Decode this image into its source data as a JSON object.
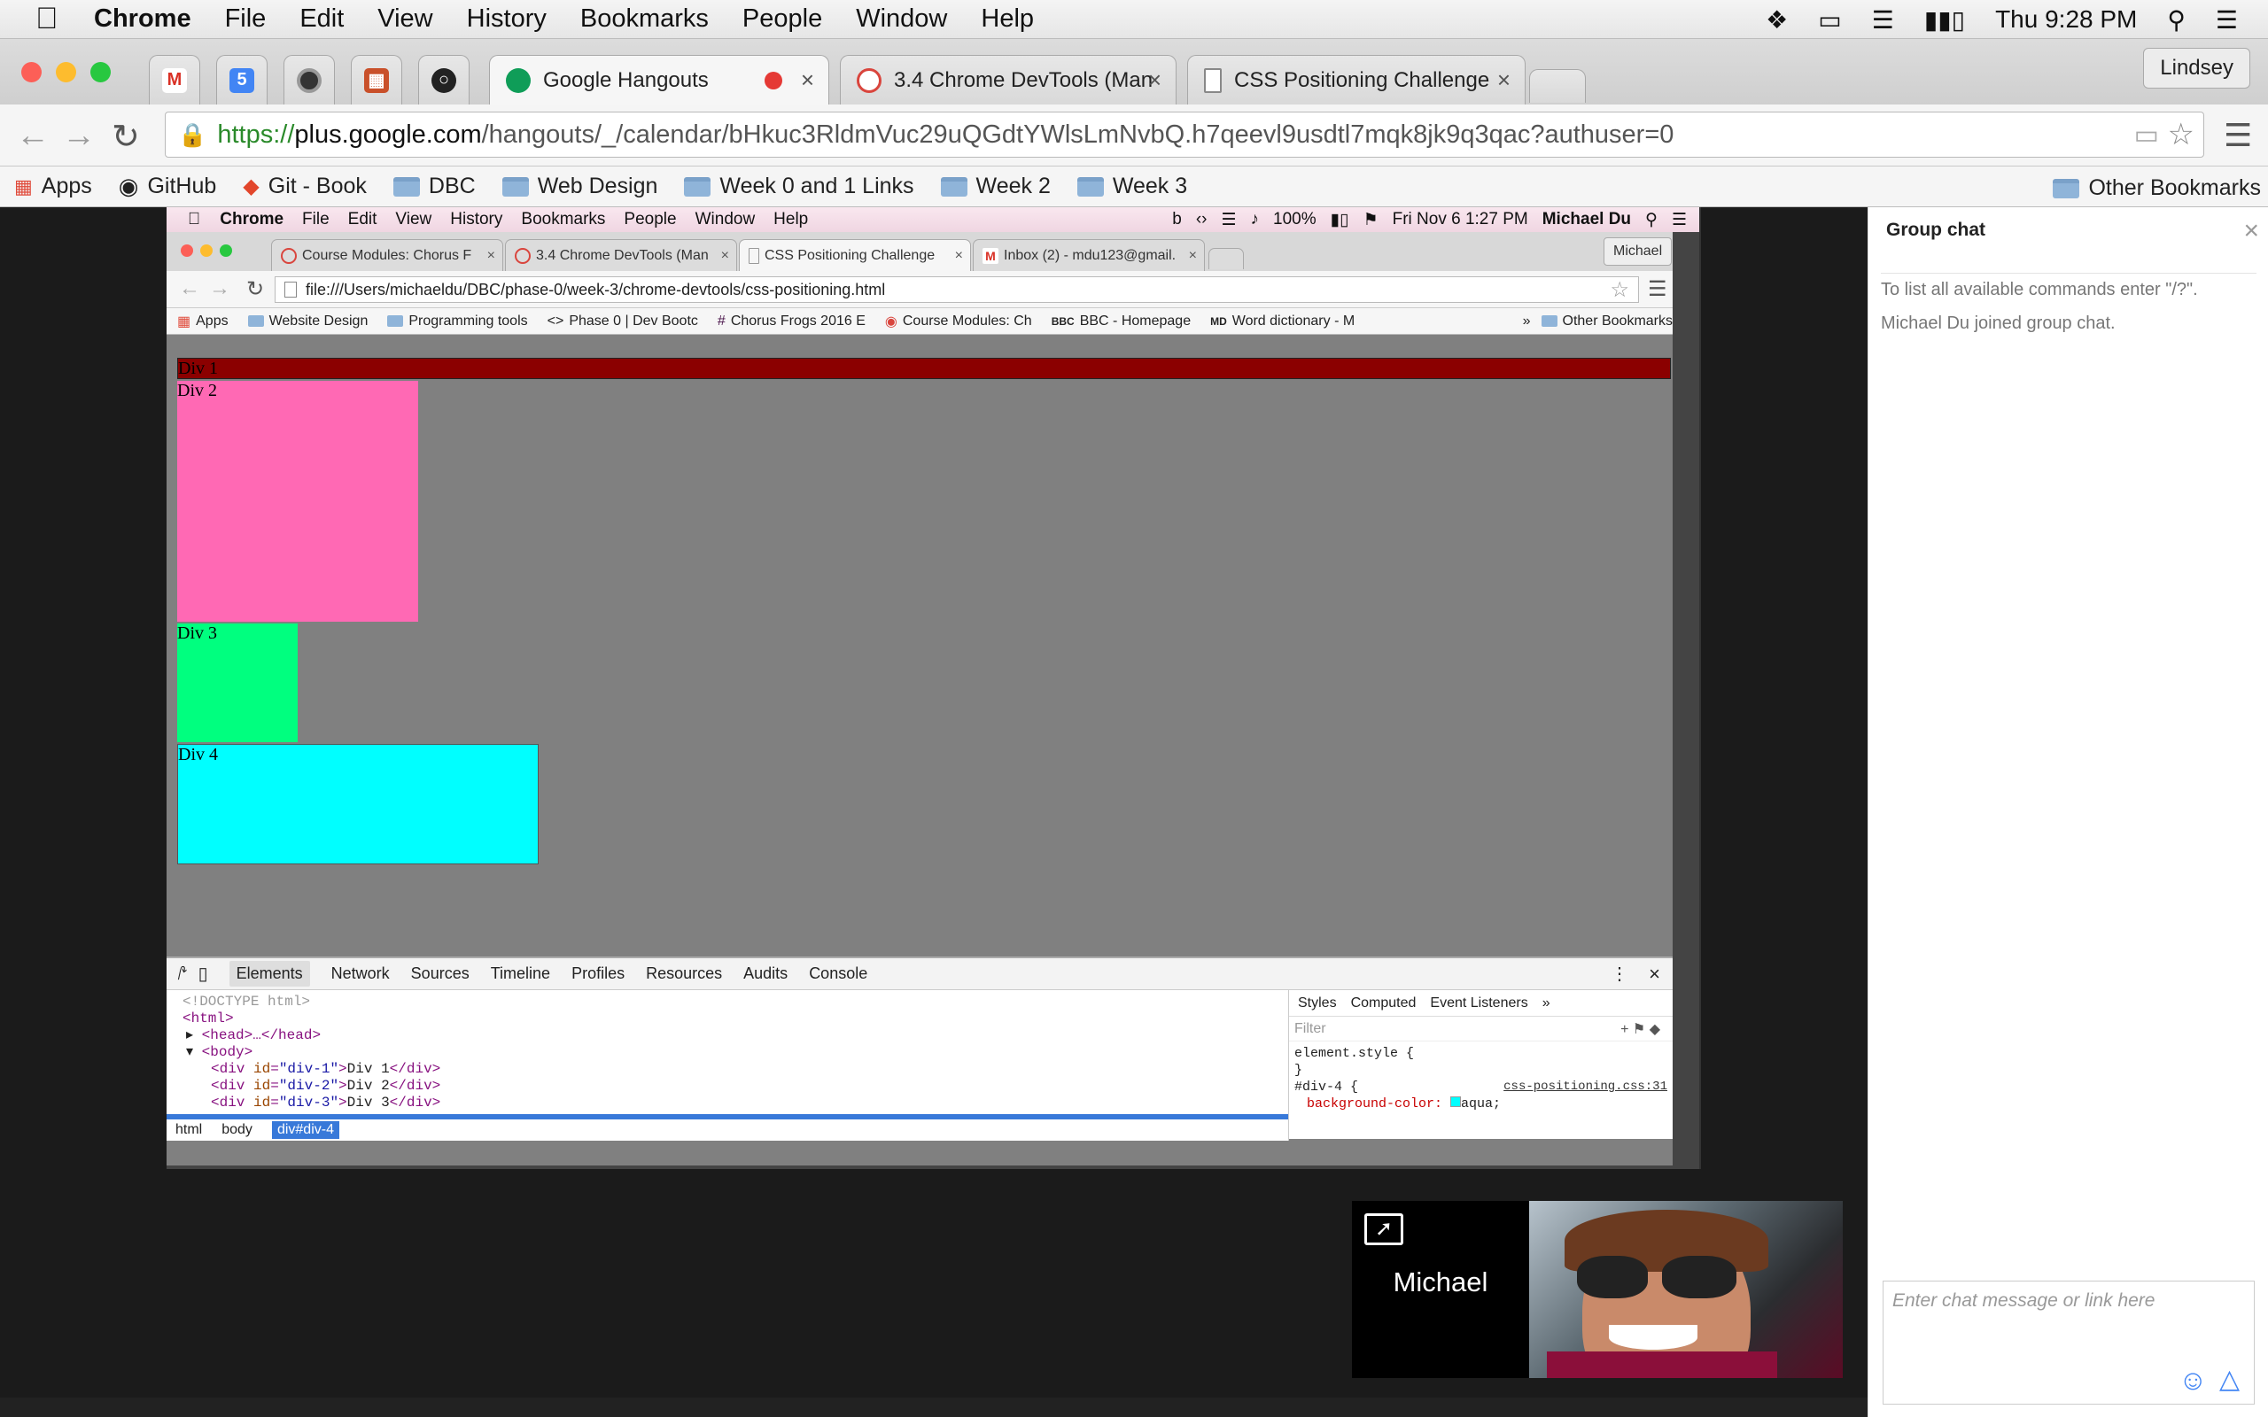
{
  "menubar": {
    "app": "Chrome",
    "items": [
      "File",
      "Edit",
      "View",
      "History",
      "Bookmarks",
      "People",
      "Window",
      "Help"
    ],
    "clock": "Thu 9:28 PM"
  },
  "tabs": [
    {
      "label": "Google Hangouts"
    },
    {
      "label": "3.4 Chrome DevTools (Man"
    },
    {
      "label": "CSS Positioning Challenge"
    }
  ],
  "profile": "Lindsey",
  "omnibox": {
    "scheme": "https://",
    "host": "plus.google.com",
    "path": "/hangouts/_/calendar/bHkuc3RldmVuc29uQGdtYWlsLmNvbQ.h7qeevl9usdtl7mqk8jk9q3qac?authuser=0"
  },
  "bookmarks": [
    "Apps",
    "GitHub",
    "Git - Book",
    "DBC",
    "Web Design",
    "Week 0 and 1 Links",
    "Week 2",
    "Week 3",
    "Other Bookmarks"
  ],
  "inner": {
    "menubar": {
      "app": "Chrome",
      "items": [
        "File",
        "Edit",
        "View",
        "History",
        "Bookmarks",
        "People",
        "Window",
        "Help"
      ],
      "battery": "100%",
      "clock": "Fri Nov 6  1:27 PM",
      "user": "Michael Du"
    },
    "tabs": [
      "Course Modules: Chorus F",
      "3.4 Chrome DevTools (Man",
      "CSS Positioning Challenge",
      "Inbox (2) - mdu123@gmail."
    ],
    "profile": "Michael",
    "url": "file:///Users/michaeldu/DBC/phase-0/week-3/chrome-devtools/css-positioning.html",
    "bookmarks": [
      "Apps",
      "Website Design",
      "Programming tools",
      "Phase 0 | Dev Bootc",
      "Chorus Frogs 2016 E",
      "Course Modules: Ch",
      "BBC - Homepage",
      "Word dictionary - M",
      "Other Bookmarks"
    ],
    "divs": [
      {
        "label": "Div 1",
        "color": "#8b0000"
      },
      {
        "label": "Div 2",
        "color": "#ff69b4"
      },
      {
        "label": "Div 3",
        "color": "#00ff7f"
      },
      {
        "label": "Div 4",
        "color": "#00ffff"
      }
    ],
    "devtools": {
      "tabs": [
        "Elements",
        "Network",
        "Sources",
        "Timeline",
        "Profiles",
        "Resources",
        "Audits",
        "Console"
      ],
      "dom": {
        "doctype": "<!DOCTYPE html>",
        "html": "<html>",
        "head": "<head>…</head>",
        "body": "<body>",
        "rows": [
          {
            "id": "\"div-1\"",
            "text": "Div 1"
          },
          {
            "id": "\"div-2\"",
            "text": "Div 2"
          },
          {
            "id": "\"div-3\"",
            "text": "Div 3"
          }
        ]
      },
      "breadcrumbs": [
        "html",
        "body",
        "div#div-4"
      ],
      "styles_tabs": [
        "Styles",
        "Computed",
        "Event Listeners",
        "»"
      ],
      "filter_placeholder": "Filter",
      "element_style": "element.style {",
      "close_brace": "}",
      "rule_selector": "#div-4 {",
      "rule_source": "css-positioning.css:31",
      "rule_prop": "background-color:",
      "rule_val": "aqua;"
    }
  },
  "chat": {
    "title": "Group chat",
    "messages": [
      "To list all available commands enter \"/?\".",
      "Michael Du joined group chat."
    ],
    "input_placeholder": "Enter chat message or link here"
  },
  "participant": {
    "name": "Michael"
  }
}
